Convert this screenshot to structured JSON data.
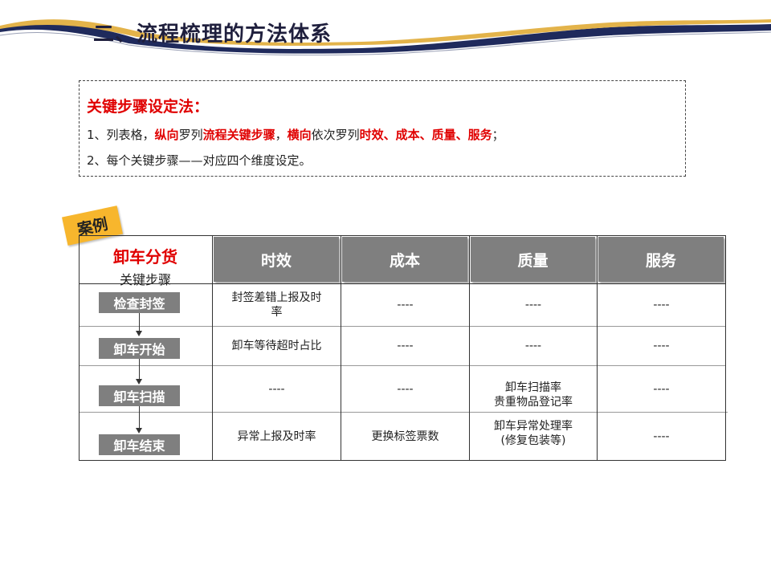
{
  "title": "二、流程梳理的方法体系",
  "method": {
    "heading": "关键步骤设定法：",
    "line1": [
      {
        "text": "1、列表格，",
        "style": "normal"
      },
      {
        "text": "纵向",
        "style": "red"
      },
      {
        "text": "罗列",
        "style": "normal"
      },
      {
        "text": "流程关键步骤",
        "style": "red"
      },
      {
        "text": "，",
        "style": "normal"
      },
      {
        "text": "横向",
        "style": "red"
      },
      {
        "text": "依次罗列",
        "style": "normal"
      },
      {
        "text": "时效、成本、质量、服务",
        "style": "red"
      },
      {
        "text": "；",
        "style": "normal"
      }
    ],
    "line2": "2、每个关键步骤——对应四个维度设定。"
  },
  "case_tag": "案例",
  "table": {
    "corner_main": "卸车分货",
    "corner_sub": "关键步骤",
    "columns": [
      "时效",
      "成本",
      "质量",
      "服务"
    ],
    "rows": [
      {
        "step": "检查封签",
        "cells": [
          "封签差错上报及时\n率",
          "----",
          "----",
          "----"
        ]
      },
      {
        "step": "卸车开始",
        "cells": [
          "卸车等待超时占比",
          "----",
          "----",
          "----"
        ]
      },
      {
        "step": "卸车扫描",
        "cells": [
          "----",
          "----",
          "卸车扫描率\n贵重物品登记率",
          "----"
        ]
      },
      {
        "step": "卸车结束",
        "cells": [
          "异常上报及时率",
          "更换标签票数",
          "卸车异常处理率\n(修复包装等)",
          "----"
        ]
      }
    ]
  },
  "colors": {
    "accent_red": "#e00000",
    "header_gray": "#7f7f7f",
    "tag_orange": "#f7b62d",
    "banner_navy": "#1f2a5c",
    "banner_gold": "#e3b34a"
  }
}
